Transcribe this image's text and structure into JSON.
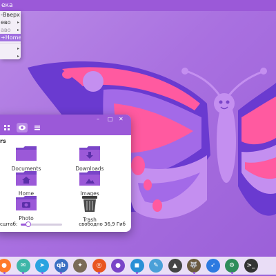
{
  "top_panel": {
    "label": "ека"
  },
  "menu": {
    "items": [
      {
        "label": "-Вверх",
        "style": "normal"
      },
      {
        "label": "ево",
        "style": "normal",
        "arrow": "▸"
      },
      {
        "label": "аво",
        "style": "dim",
        "arrow": "▸"
      },
      {
        "label": "+Home",
        "style": "active"
      },
      {
        "label": "",
        "style": "normal",
        "arrow": "▸"
      },
      {
        "label": "",
        "style": "normal",
        "arrow": "▸"
      }
    ]
  },
  "file_manager": {
    "window_buttons": {
      "minimize": "–",
      "maximize": "□",
      "close": "✕"
    },
    "toolbar_icons": [
      "grid-view-icon",
      "icon-view-icon",
      "list-view-icon"
    ],
    "section_title": "rs",
    "folders": [
      {
        "label": "Documents",
        "icon": "documents-folder-icon",
        "glyph": ""
      },
      {
        "label": "Downloads",
        "icon": "downloads-folder-icon",
        "glyph": "⬇"
      },
      {
        "label": "Home",
        "icon": "home-folder-icon",
        "glyph": "⌂"
      },
      {
        "label": "Images",
        "icon": "images-folder-icon",
        "glyph": "▲"
      },
      {
        "label": "Photo",
        "icon": "photo-folder-icon",
        "glyph": "◉"
      },
      {
        "label": "Trash",
        "icon": "trash-icon",
        "glyph": ""
      }
    ],
    "status": {
      "zoom_label": "сштаб:",
      "zoom_fraction": 0.18,
      "free_space": "свободно 36,9 Гиб"
    }
  },
  "dock": {
    "apps": [
      {
        "name": "firefox-icon",
        "glyph": "●",
        "color": "#ff7a2a"
      },
      {
        "name": "mail-icon",
        "glyph": "✉",
        "color": "#3db6a8"
      },
      {
        "name": "telegram-icon",
        "glyph": "➤",
        "color": "#2aa3e0"
      },
      {
        "name": "qbittorrent-icon",
        "glyph": "qb",
        "color": "#3a6fc2"
      },
      {
        "name": "inkscape-bird-icon",
        "glyph": "✦",
        "color": "#7a6a58"
      },
      {
        "name": "ubuntu-icon",
        "glyph": "◎",
        "color": "#e95420"
      },
      {
        "name": "github-icon",
        "glyph": "●",
        "color": "#7a45c8"
      },
      {
        "name": "blue-box-app-icon",
        "glyph": "◼",
        "color": "#2a8fd6"
      },
      {
        "name": "drawing-app-icon",
        "glyph": "✎",
        "color": "#4aa0d8"
      },
      {
        "name": "inkscape-icon",
        "glyph": "▲",
        "color": "#444444"
      },
      {
        "name": "gimp-icon",
        "glyph": "🐺",
        "color": "#6b5a3f"
      },
      {
        "name": "thunderbird-icon",
        "glyph": "➶",
        "color": "#2d7ae0"
      },
      {
        "name": "settings-gear-icon",
        "glyph": "⚙",
        "color": "#2e8c5a"
      },
      {
        "name": "terminal-icon",
        "glyph": ">_",
        "color": "#333333"
      }
    ]
  },
  "colors": {
    "panel": "#9b59d8",
    "accent_pink": "#ff5aa0",
    "butterfly_body": "#c48ff0",
    "butterfly_dark": "#6a3ad0"
  }
}
